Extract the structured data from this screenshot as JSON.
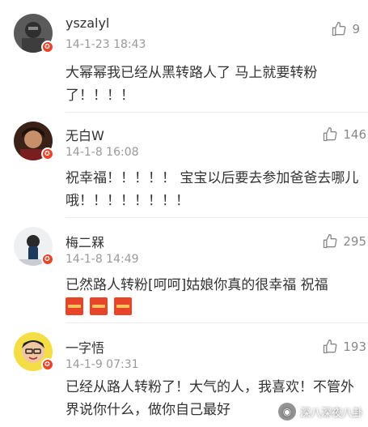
{
  "comments": [
    {
      "name": "yszalyl",
      "time": "14-1-23 18:43",
      "likes": "9",
      "text": "大幂幂我已经从黑转路人了 马上就要转粉了！！！！"
    },
    {
      "name": "无白W",
      "time": "14-1-8 16:08",
      "likes": "146",
      "text": "祝幸福！！！！！ 宝宝以后要去参加爸爸去哪儿哦！！！！！！！！"
    },
    {
      "name": "梅二槑",
      "time": "14-1-8 14:49",
      "likes": "295",
      "text": "已然路人转粉[呵呵]姑娘你真的很幸福 祝福"
    },
    {
      "name": "一字悟",
      "time": "14-1-9 07:31",
      "likes": "193",
      "text": "已经从路人转粉了！大气的人，我喜欢！不管外界说你什么，做你自己最好"
    }
  ],
  "badge_glyph": "✪",
  "icons": {
    "like": "thumbs-up-icon",
    "badge": "verified-badge-icon",
    "envelope": "red-envelope-icon"
  },
  "watermark": {
    "text": "深八深夜八卦",
    "icon": "wechat-icon"
  },
  "colors": {
    "badge": "#e8442a",
    "text": "#333333",
    "meta": "#999999"
  }
}
